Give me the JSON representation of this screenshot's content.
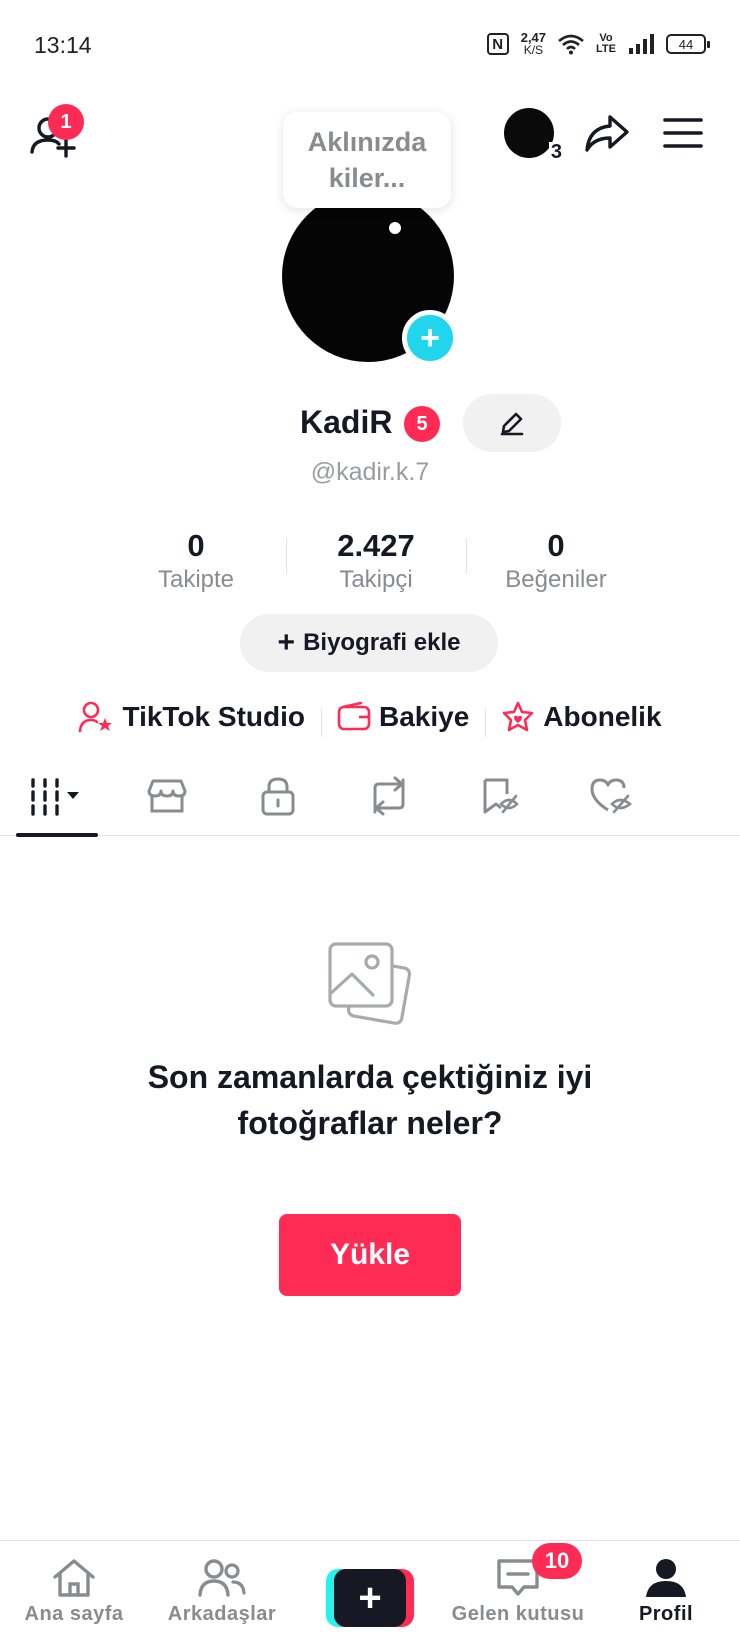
{
  "status_bar": {
    "time": "13:14",
    "nfc": "N",
    "speed_value": "2,47",
    "speed_unit": "K/S",
    "volte_top": "Vo",
    "volte_bottom": "LTE",
    "battery": "44"
  },
  "top_bar": {
    "add_friends_badge": "1",
    "account_count": "3"
  },
  "profile": {
    "bubble_text": "Aklınızda kiler...",
    "name": "KadiR",
    "name_badge": "5",
    "username": "@kadir.k.7"
  },
  "stats": [
    {
      "value": "0",
      "label": "Takipte"
    },
    {
      "value": "2.427",
      "label": "Takipçi"
    },
    {
      "value": "0",
      "label": "Beğeniler"
    }
  ],
  "bio_button": {
    "plus": "+",
    "label": "Biyografi ekle"
  },
  "tools": [
    {
      "label": "TikTok Studio",
      "icon": "user-star-icon"
    },
    {
      "label": "Bakiye",
      "icon": "wallet-icon"
    },
    {
      "label": "Abonelik",
      "icon": "star-heart-icon"
    }
  ],
  "tabs": [
    "grid-icon",
    "shop-icon",
    "lock-icon",
    "repost-icon",
    "bookmark-hidden-icon",
    "heart-hidden-icon"
  ],
  "empty_state": {
    "title": "Son zamanlarda çektiğiniz iyi fotoğraflar neler?",
    "button": "Yükle"
  },
  "bottom_nav": {
    "home": "Ana sayfa",
    "friends": "Arkadaşlar",
    "create": "+",
    "inbox": "Gelen kutusu",
    "inbox_badge": "10",
    "profile": "Profil"
  },
  "colors": {
    "accent": "#fe2c55",
    "cyan": "#20d5ec",
    "text": "#161823",
    "muted": "#8a8b91"
  }
}
